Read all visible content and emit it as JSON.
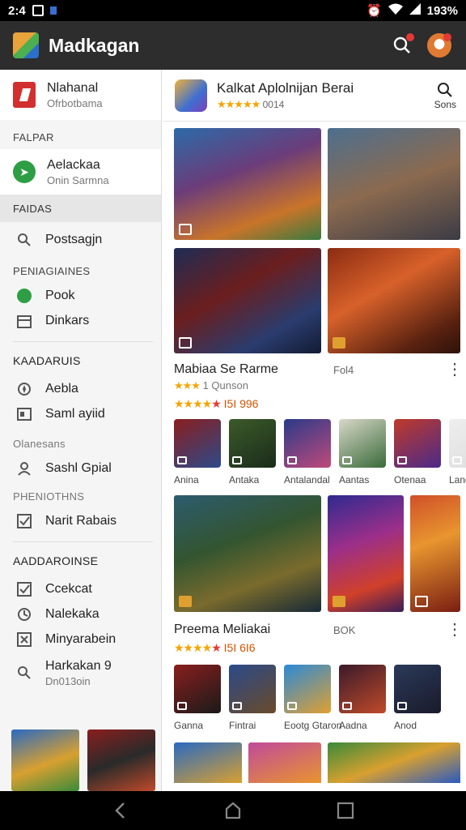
{
  "status": {
    "time": "2:4",
    "battery": "193%"
  },
  "appbar": {
    "title": "Madkagan"
  },
  "sidebar": {
    "account": {
      "line1": "Nlahanal",
      "line2": "Ofrbotbama"
    },
    "section1": "FALPAR",
    "active": {
      "line1": "Aelackaa",
      "line2": "Onin Sarmna"
    },
    "section2": "FAIDAS",
    "items_a": [
      {
        "label": "Postsagjn",
        "icon": "search-icon"
      }
    ],
    "section3": "PENIAGIAINES",
    "items_b": [
      {
        "label": "Pook",
        "icon": "circle-icon"
      },
      {
        "label": "Dinkars",
        "icon": "calendar-icon"
      }
    ],
    "section4": "KAADARUIS",
    "items_c": [
      {
        "label": "Aebla",
        "icon": "compass-icon"
      },
      {
        "label": "Saml ayiid",
        "icon": "card-icon"
      }
    ],
    "section5": "Olanesans",
    "items_d": [
      {
        "label": "Sashl Gpial",
        "icon": "person-icon"
      }
    ],
    "section6": "PHENIOTHNS",
    "items_e": [
      {
        "label": "Narit Rabais",
        "icon": "check-box-icon"
      }
    ],
    "section7": "AADDAROINSE",
    "items_f": [
      {
        "label": "Ccekcat",
        "icon": "check-box-icon"
      },
      {
        "label": "Nalekaka",
        "icon": "clock-icon"
      },
      {
        "label": "Minyarabein",
        "icon": "x-box-icon"
      }
    ],
    "last": {
      "line1": "Harkakan 9",
      "line2": "Dn013oin"
    }
  },
  "feature": {
    "title": "Kalkat Aplolnijan Berai",
    "rating_text": "0014",
    "search_label": "Sons"
  },
  "section1": {
    "title": "Mabiaa Se Rarme",
    "right": "Fol4",
    "sub": "1 Qunson",
    "rating_text": "I5I 996"
  },
  "apps1": [
    {
      "name": "Anina",
      "c1": "#8a1e1e",
      "c2": "#2c4a8a"
    },
    {
      "name": "Antaka",
      "c1": "#3c5a2a",
      "c2": "#1a2c1a"
    },
    {
      "name": "Antalandal",
      "c1": "#2a3a8a",
      "c2": "#c04a7a"
    },
    {
      "name": "Aantas",
      "c1": "#d8d8c8",
      "c2": "#3a6a3a"
    },
    {
      "name": "Otenaa",
      "c1": "#c03a2a",
      "c2": "#4a2a8a"
    },
    {
      "name": "Land",
      "c1": "#eeeeee",
      "c2": "#dddddd"
    }
  ],
  "section2": {
    "title": "Preema Meliakai",
    "right": "BOK",
    "rating_text": "I5I 6I6"
  },
  "apps2": [
    {
      "name": "Ganna",
      "c1": "#8a1e1e",
      "c2": "#1a1a1a"
    },
    {
      "name": "Fintrai",
      "c1": "#2a4a8a",
      "c2": "#6a4a2a"
    },
    {
      "name": "Eootg Gtaron",
      "c1": "#2a8ad8",
      "c2": "#e0a030"
    },
    {
      "name": "Aadna",
      "c1": "#3a1a2a",
      "c2": "#c04a2a"
    },
    {
      "name": "Anod",
      "c1": "#2a3a5a",
      "c2": "#1a1a2a"
    }
  ]
}
